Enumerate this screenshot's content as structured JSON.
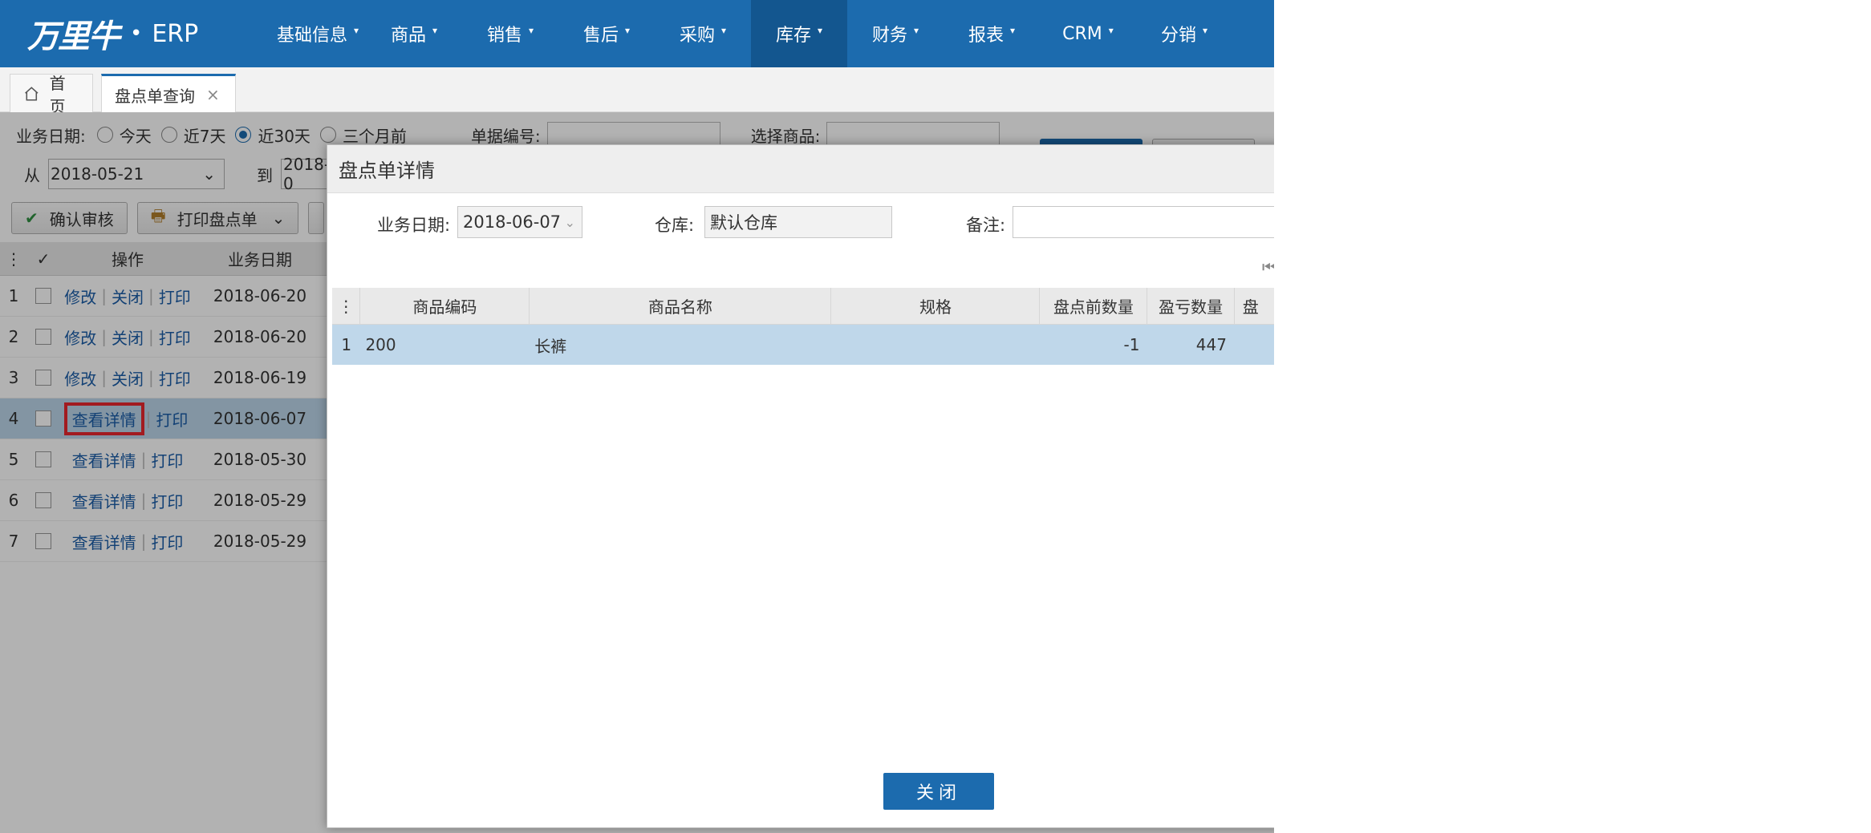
{
  "app": {
    "logo_mark": "万里牛",
    "logo_dot": "•",
    "logo_text": "ERP"
  },
  "nav": {
    "items": [
      {
        "label": "基础信息"
      },
      {
        "label": "商品"
      },
      {
        "label": "销售"
      },
      {
        "label": "售后"
      },
      {
        "label": "采购"
      },
      {
        "label": "库存"
      },
      {
        "label": "财务"
      },
      {
        "label": "报表"
      },
      {
        "label": "CRM"
      },
      {
        "label": "分销"
      }
    ],
    "active_index": 5
  },
  "tabs": {
    "home": "首页",
    "current": "盘点单查询",
    "close_glyph": "×"
  },
  "filters": {
    "date_label": "业务日期:",
    "options": [
      "今天",
      "近7天",
      "近30天",
      "三个月前"
    ],
    "selected_index": 2,
    "bill_no_label": "单据编号:",
    "goods_label": "选择商品:",
    "from_label": "从",
    "from_value": "2018-05-21",
    "to_label": "到",
    "to_value": "2018-0"
  },
  "toolbar": {
    "confirm_label": "确认审核",
    "print_label": "打印盘点单"
  },
  "grid": {
    "headers": {
      "op": "操作",
      "date": "业务日期"
    },
    "rows": [
      {
        "idx": "1",
        "ops": [
          "修改",
          "关闭",
          "打印"
        ],
        "date": "2018-06-20"
      },
      {
        "idx": "2",
        "ops": [
          "修改",
          "关闭",
          "打印"
        ],
        "date": "2018-06-20"
      },
      {
        "idx": "3",
        "ops": [
          "修改",
          "关闭",
          "打印"
        ],
        "date": "2018-06-19"
      },
      {
        "idx": "4",
        "ops": [
          "查看详情",
          "打印"
        ],
        "date": "2018-06-07"
      },
      {
        "idx": "5",
        "ops": [
          "查看详情",
          "打印"
        ],
        "date": "2018-05-30"
      },
      {
        "idx": "6",
        "ops": [
          "查看详情",
          "打印"
        ],
        "date": "2018-05-29"
      },
      {
        "idx": "7",
        "ops": [
          "查看详情",
          "打印"
        ],
        "date": "2018-05-29"
      }
    ],
    "selected_row": 3
  },
  "dialog": {
    "title": "盘点单详情",
    "date_label": "业务日期:",
    "date_value": "2018-06-07",
    "warehouse_label": "仓库:",
    "warehouse_value": "默认仓库",
    "note_label": "备注:",
    "note_value": "",
    "headers": {
      "code": "商品编码",
      "name": "商品名称",
      "spec": "规格",
      "before_qty": "盘点前数量",
      "pl_qty": "盈亏数量",
      "more": "盘"
    },
    "rows": [
      {
        "idx": "1",
        "code": "200",
        "name": "长裤",
        "spec": "",
        "before_qty": "-1",
        "pl_qty": "447"
      }
    ],
    "close_label": "关闭"
  }
}
